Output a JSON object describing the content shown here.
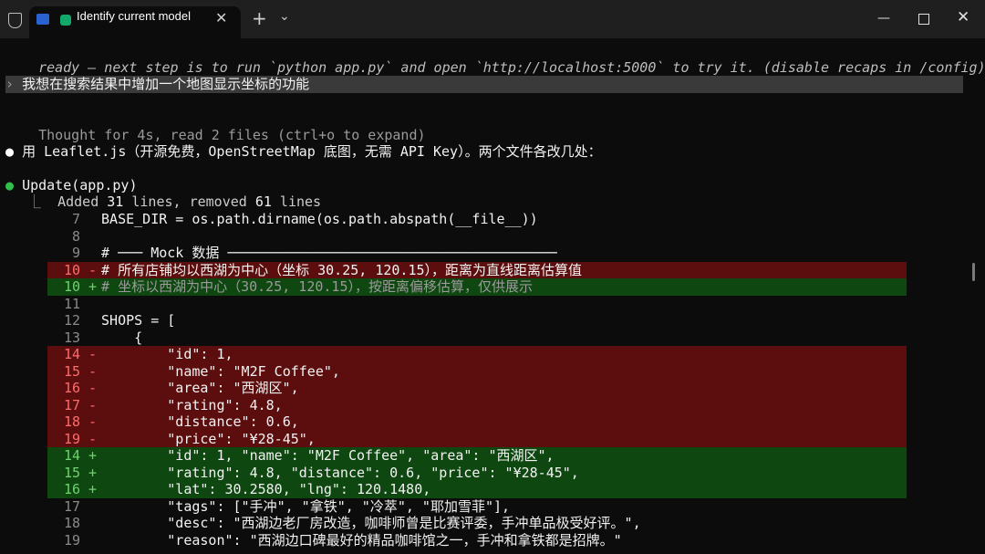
{
  "window": {
    "tab_title": "Identify current model",
    "new_tab_label": "+",
    "dropdown_label": "⌄",
    "close_tab_label": "✕",
    "minimize_label": "—",
    "close_label": "✕"
  },
  "terminal": {
    "recap_line": "ready — next step is to run `python app.py` and open `http://localhost:5000` to try it. (disable recaps in /config)",
    "prompt_marker": "›",
    "user_prompt": "我想在搜索结果中增加一个地图显示坐标的功能",
    "thought_line": "Thought for 4s, read 2 files (ctrl+o to expand)",
    "bullet": "●",
    "assistant_line": "用 Leaflet.js（开源免费，OpenStreetMap 底图，无需 API Key）。两个文件各改几处：",
    "update_label": "Update(app.py)",
    "summary": {
      "tree": "⎿",
      "added_prefix": "Added ",
      "added_count": "31",
      "lines_removed_text": " lines, removed ",
      "removed_count": "61",
      "lines_suffix": " lines"
    }
  },
  "diff_lines": [
    {
      "type": "ctx",
      "num": "7",
      "mark": "",
      "text": "BASE_DIR = os.path.dirname(os.path.abspath(__file__))"
    },
    {
      "type": "ctx",
      "num": "8",
      "mark": "",
      "text": ""
    },
    {
      "type": "ctx",
      "num": "9",
      "mark": "",
      "text": "# ─── Mock 数据 ────────────────────────────────────────"
    },
    {
      "type": "del",
      "num": "10",
      "mark": "-",
      "text": "# 所有店铺均以西湖为中心（坐标 30.25, 120.15），距离为直线距离估算值"
    },
    {
      "type": "add",
      "num": "10",
      "mark": "+",
      "text": "# 坐标以西湖为中心（30.25, 120.15），按距离偏移估算，仅供展示"
    },
    {
      "type": "ctx",
      "num": "11",
      "mark": "",
      "text": ""
    },
    {
      "type": "ctx",
      "num": "12",
      "mark": "",
      "text": "SHOPS = ["
    },
    {
      "type": "ctx",
      "num": "13",
      "mark": "",
      "text": "    {"
    },
    {
      "type": "del",
      "num": "14",
      "mark": "-",
      "text": "        \"id\": 1,"
    },
    {
      "type": "del",
      "num": "15",
      "mark": "-",
      "text": "        \"name\": \"M2F Coffee\","
    },
    {
      "type": "del",
      "num": "16",
      "mark": "-",
      "text": "        \"area\": \"西湖区\","
    },
    {
      "type": "del",
      "num": "17",
      "mark": "-",
      "text": "        \"rating\": 4.8,"
    },
    {
      "type": "del",
      "num": "18",
      "mark": "-",
      "text": "        \"distance\": 0.6,"
    },
    {
      "type": "del",
      "num": "19",
      "mark": "-",
      "text": "        \"price\": \"¥28-45\","
    },
    {
      "type": "add",
      "num": "14",
      "mark": "+",
      "text": "        \"id\": 1, \"name\": \"M2F Coffee\", \"area\": \"西湖区\","
    },
    {
      "type": "add",
      "num": "15",
      "mark": "+",
      "text": "        \"rating\": 4.8, \"distance\": 0.6, \"price\": \"¥28-45\","
    },
    {
      "type": "add",
      "num": "16",
      "mark": "+",
      "text": "        \"lat\": 30.2580, \"lng\": 120.1480,"
    },
    {
      "type": "ctx",
      "num": "17",
      "mark": "",
      "text": "        \"tags\": [\"手冲\", \"拿铁\", \"冷萃\", \"耶加雪菲\"],"
    },
    {
      "type": "ctx",
      "num": "18",
      "mark": "",
      "text": "        \"desc\": \"西湖边老厂房改造，咖啡师曾是比赛评委，手冲单品极受好评。\","
    },
    {
      "type": "ctx",
      "num": "19",
      "mark": "",
      "text": "        \"reason\": \"西湖边口碑最好的精品咖啡馆之一，手冲和拿铁都是招牌。\""
    }
  ]
}
